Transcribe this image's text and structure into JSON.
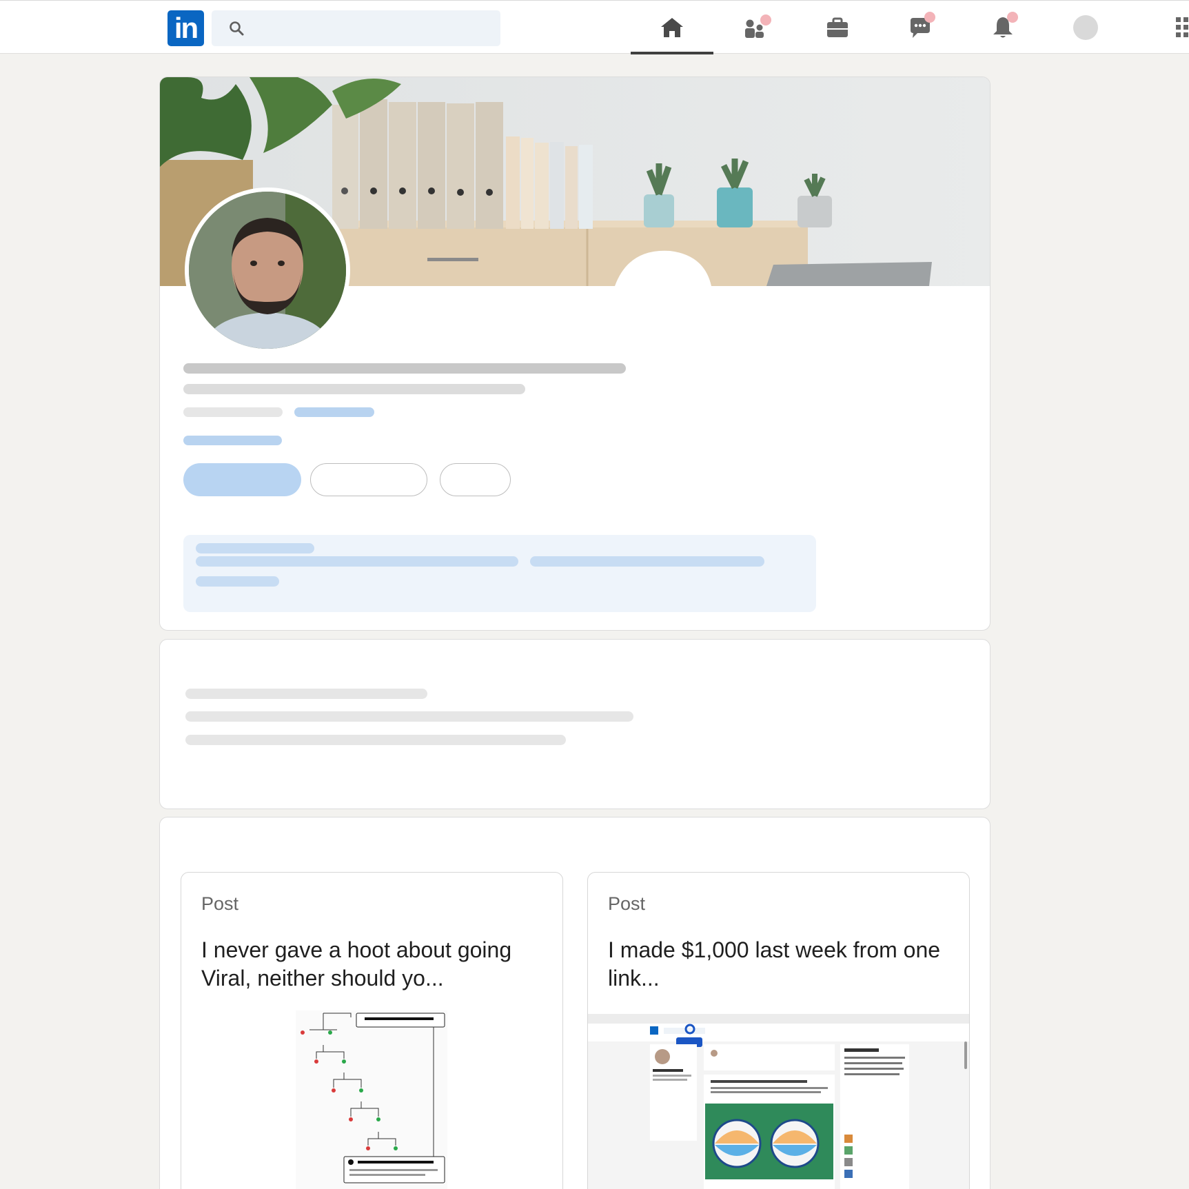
{
  "nav": {
    "logo_text": "in",
    "search_placeholder": "",
    "items": [
      {
        "name": "home",
        "active": true,
        "badge": false
      },
      {
        "name": "my-network",
        "active": false,
        "badge": true
      },
      {
        "name": "jobs",
        "active": false,
        "badge": false
      },
      {
        "name": "messaging",
        "active": false,
        "badge": true
      },
      {
        "name": "notifications",
        "active": false,
        "badge": true
      },
      {
        "name": "me",
        "active": false,
        "badge": false
      }
    ]
  },
  "colors": {
    "brand": "#0a66c2",
    "page_bg": "#f3f2ef",
    "badge": "#f3b3b8",
    "skeleton_blue": "#b8d3f0",
    "skeleton_gray": "#c8c8c8"
  },
  "activity": {
    "posts": [
      {
        "kind": "Post",
        "headline": "I never gave a hoot about going Viral, neither should yo..."
      },
      {
        "kind": "Post",
        "headline": "I made $1,000 last week from one link..."
      }
    ]
  }
}
